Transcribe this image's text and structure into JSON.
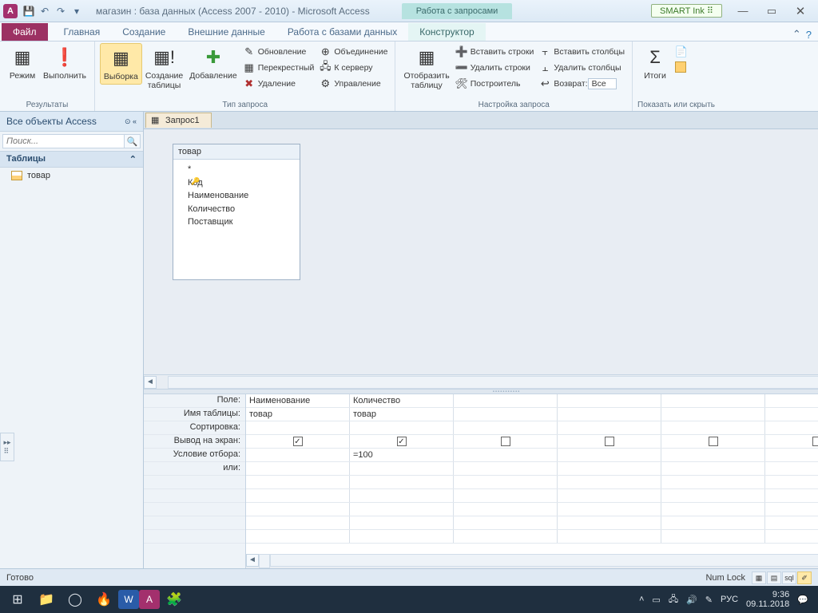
{
  "titlebar": {
    "title": "магазин : база данных (Access 2007 - 2010)  -  Microsoft Access",
    "contextual_title": "Работа с запросами",
    "smart_ink": "SMART Ink"
  },
  "tabs": {
    "file": "Файл",
    "items": [
      "Главная",
      "Создание",
      "Внешние данные",
      "Работа с базами данных"
    ],
    "contextual": "Конструктор"
  },
  "ribbon": {
    "results": {
      "label": "Результаты",
      "mode": "Режим",
      "run": "Выполнить"
    },
    "querytype": {
      "label": "Тип запроса",
      "select": "Выборка",
      "maketable": "Создание\nтаблицы",
      "append": "Добавление",
      "update": "Обновление",
      "crosstab": "Перекрестный",
      "delete": "Удаление",
      "union": "Объединение",
      "passthrough": "К серверу",
      "datadef": "Управление"
    },
    "show": {
      "label": "",
      "showtable": "Отобразить\nтаблицу"
    },
    "setup": {
      "label": "Настройка запроса",
      "insertrows": "Вставить строки",
      "deleterows": "Удалить строки",
      "builder": "Построитель",
      "insertcols": "Вставить столбцы",
      "deletecols": "Удалить столбцы",
      "return": "Возврат:",
      "return_val": "Все"
    },
    "showhide": {
      "label": "Показать или скрыть",
      "totals": "Итоги"
    }
  },
  "nav": {
    "header": "Все объекты Access",
    "search_placeholder": "Поиск...",
    "category": "Таблицы",
    "items": [
      "товар"
    ]
  },
  "document": {
    "tab_title": "Запрос1",
    "table": {
      "name": "товар",
      "fields": [
        "*",
        "Код",
        "Наименование",
        "Количество",
        "Поставщик"
      ]
    }
  },
  "grid": {
    "labels": [
      "Поле:",
      "Имя таблицы:",
      "Сортировка:",
      "Вывод на экран:",
      "Условие отбора:",
      "или:"
    ],
    "cols": [
      {
        "field": "Наименование",
        "table": "товар",
        "show": true,
        "criteria": ""
      },
      {
        "field": "Количество",
        "table": "товар",
        "show": true,
        "criteria": "=100"
      },
      {
        "field": "",
        "table": "",
        "show": false,
        "criteria": ""
      },
      {
        "field": "",
        "table": "",
        "show": false,
        "criteria": ""
      },
      {
        "field": "",
        "table": "",
        "show": false,
        "criteria": ""
      },
      {
        "field": "",
        "table": "",
        "show": false,
        "criteria": ""
      }
    ]
  },
  "status": {
    "ready": "Готово",
    "numlock": "Num Lock"
  },
  "taskbar": {
    "lang": "РУС",
    "time": "9:36",
    "date": "09.11.2018"
  }
}
